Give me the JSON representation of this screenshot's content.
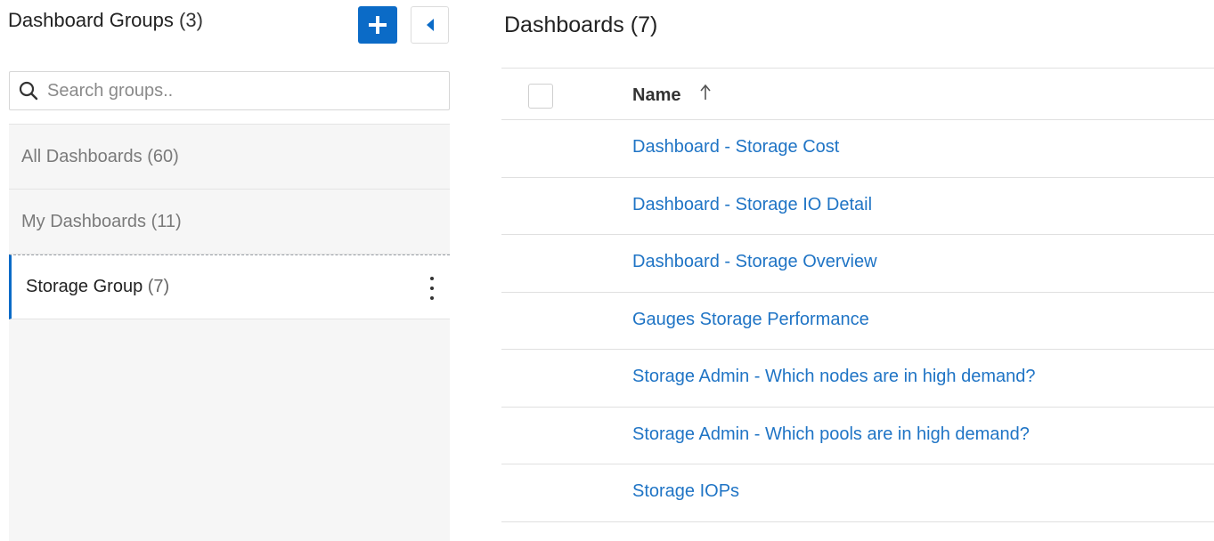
{
  "groups_panel": {
    "title": "Dashboard Groups",
    "count": "(3)",
    "add_icon": "plus-icon",
    "collapse_icon": "caret-left-icon",
    "search": {
      "placeholder": "Search groups..",
      "value": "",
      "icon": "search-icon"
    },
    "items": [
      {
        "label": "All Dashboards",
        "count": "(60)"
      },
      {
        "label": "My Dashboards",
        "count": "(11)"
      },
      {
        "label": "Storage Group",
        "count": "(7)",
        "selected": true,
        "menu_icon": "kebab-menu-icon"
      }
    ]
  },
  "dashboards_panel": {
    "title": "Dashboards",
    "count": "(7)",
    "columns": [
      {
        "label": "Name",
        "sort": "ascending",
        "sort_icon": "sort-up-arrow-icon"
      }
    ],
    "rows": [
      "Dashboard - Storage Cost",
      "Dashboard - Storage IO Detail",
      "Dashboard - Storage Overview",
      "Gauges Storage Performance",
      "Storage Admin - Which nodes are in high demand?",
      "Storage Admin - Which pools are in high demand?",
      "Storage IOPs"
    ]
  },
  "colors": {
    "accent": "#0b6bc7",
    "link": "#1f74c5",
    "sidebar_bg": "#f6f6f6"
  }
}
